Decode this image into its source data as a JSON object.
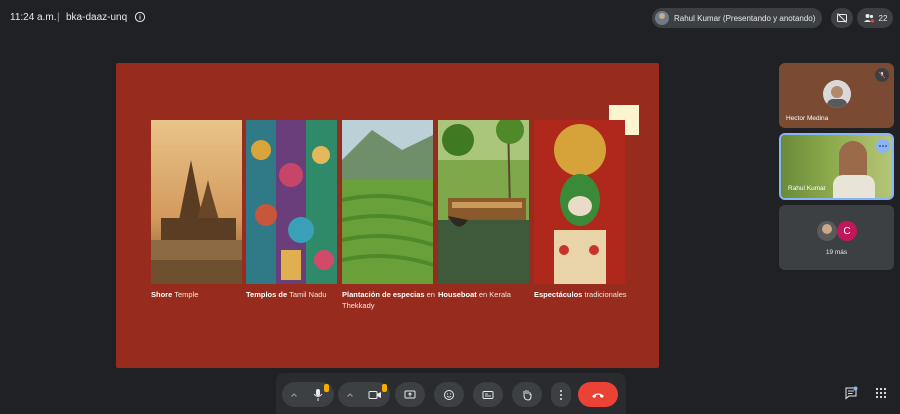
{
  "meeting": {
    "time": "11:24 a.m.",
    "separator": "|",
    "code": "bka-daaz-unq"
  },
  "presenter_chip": {
    "label": "Rahul Kumar (Presentando y anotando)"
  },
  "people_count": "22",
  "slide": {
    "cards": [
      {
        "bold": "Shore",
        "rest": " Temple"
      },
      {
        "bold": "Templos de",
        "rest": " Tamil Nadu"
      },
      {
        "bold": "Plantación de especias",
        "rest": " en Thekkady"
      },
      {
        "bold": "Houseboat",
        "rest": " en Kerala"
      },
      {
        "bold": "Espectáculos",
        "rest": " tradicionales"
      }
    ]
  },
  "participants": {
    "tile1_name": "Hector Medina",
    "tile2_name": "Rahul Kumar",
    "others_initial": "C",
    "others_label": "19 más"
  },
  "colors": {
    "background": "#202124",
    "slide": "#972c1e",
    "accent_red": "#ea4335",
    "badge_yellow": "#f9ab00",
    "active_tile_border": "#8ab4f8"
  },
  "icons": {
    "info": "info-icon",
    "present_off": "present-off-icon",
    "people": "people-icon",
    "mic": "mic-icon",
    "camera": "camera-icon",
    "present": "present-screen-icon",
    "emoji": "emoji-icon",
    "captions": "captions-icon",
    "hand": "raise-hand-icon",
    "more": "more-vert-icon",
    "hangup": "hangup-icon",
    "chat": "chat-icon",
    "apps": "apps-grid-icon",
    "muted": "mic-off-icon"
  }
}
